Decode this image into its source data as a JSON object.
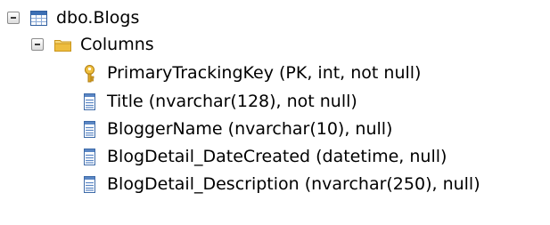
{
  "tree": {
    "table": {
      "label": "dbo.Blogs",
      "icon": "table-icon",
      "expanded": true
    },
    "columns_folder": {
      "label": "Columns",
      "icon": "folder-icon",
      "expanded": true
    },
    "columns": [
      {
        "label": "PrimaryTrackingKey (PK, int, not null)",
        "icon": "primary-key-icon"
      },
      {
        "label": "Title (nvarchar(128), not null)",
        "icon": "column-icon"
      },
      {
        "label": "BloggerName (nvarchar(10), null)",
        "icon": "column-icon"
      },
      {
        "label": "BlogDetail_DateCreated (datetime, null)",
        "icon": "column-icon"
      },
      {
        "label": "BlogDetail_Description (nvarchar(250), null)",
        "icon": "column-icon"
      }
    ]
  },
  "colors": {
    "table_icon_blue": "#3c6fb4",
    "folder_yellow": "#e8b830",
    "key_gold": "#d8a21c",
    "column_icon_blue": "#5a86c4"
  }
}
